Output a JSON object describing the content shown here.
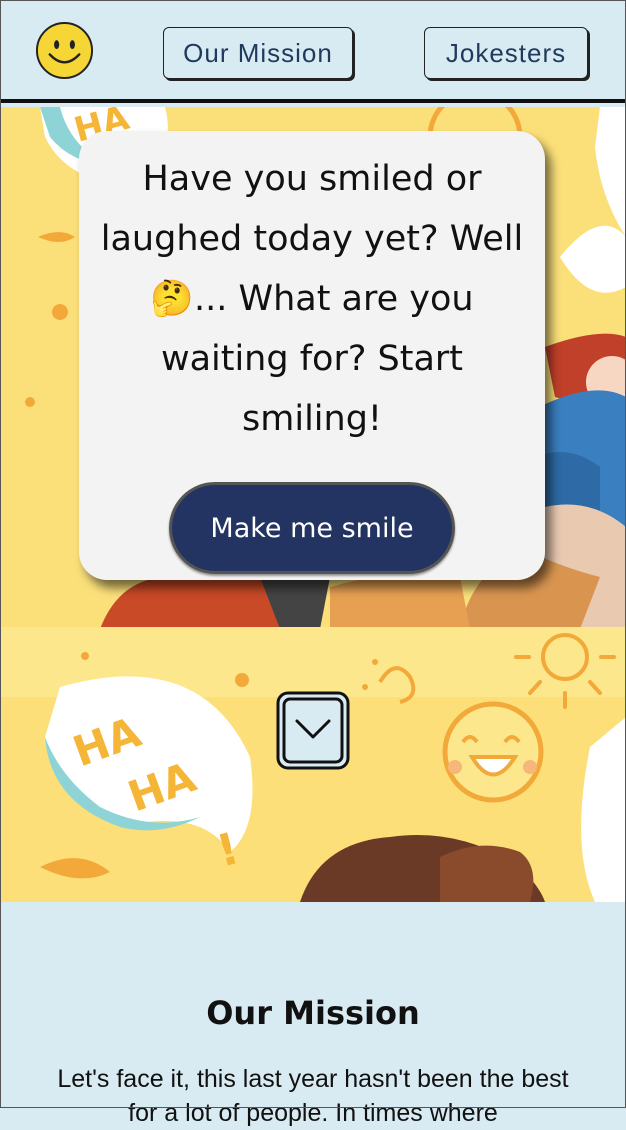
{
  "header": {
    "nav": [
      {
        "label": "Our Mission"
      },
      {
        "label": "Jokesters"
      }
    ]
  },
  "hero": {
    "message": "Have you smiled or laughed today yet? Well 🤔... What are you waiting for? Start smiling!",
    "cta_label": "Make me smile",
    "illustration_text": [
      "HA",
      "HA",
      "!"
    ]
  },
  "icons": {
    "logo": "smiley-icon",
    "scroll": "chevron-down-icon",
    "thinking": "thinking-face-emoji"
  },
  "mission": {
    "title": "Our Mission",
    "body": "Let's face it, this last year hasn't been the best for a lot of people. In times where"
  },
  "colors": {
    "header_bg": "#d9ebf2",
    "hero_bg": "#fbe07a",
    "card_bg": "#f3f3f3",
    "cta_bg": "#233462",
    "nav_text": "#1f3a5c",
    "smiley_yellow": "#f6d635"
  }
}
